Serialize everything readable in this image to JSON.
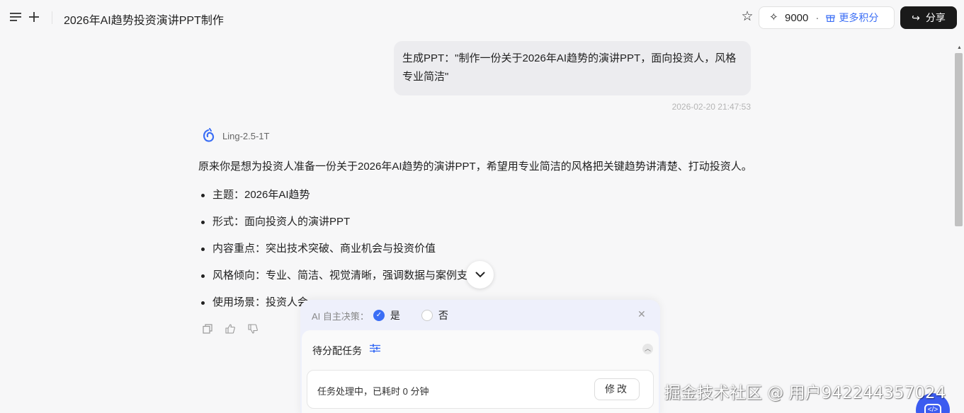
{
  "header": {
    "title": "2026年AI趋势投资演讲PPT制作",
    "points_value": "9000",
    "points_separator": "·",
    "more_points_label": "更多积分",
    "share_label": "分享"
  },
  "conversation": {
    "user_message": "生成PPT：\"制作一份关于2026年AI趋势的演讲PPT，面向投资人，风格专业简洁\"",
    "timestamp": "2026-02-20 21:47:53",
    "model_name": "Ling-2.5-1T",
    "answer_intro": "原来你是想为投资人准备一份关于2026年AI趋势的演讲PPT，希望用专业简洁的风格把关键趋势讲清楚、打动投资人。",
    "bullets": [
      "主题：2026年AI趋势",
      "形式：面向投资人的演讲PPT",
      "内容重点：突出技术突破、商业机会与投资价值",
      "风格倾向：专业、简洁、视觉清晰，强调数据与案例支",
      "使用场景：投资人会"
    ]
  },
  "task_panel": {
    "ai_decision_label": "AI 自主决策：",
    "yes_label": "是",
    "no_label": "否",
    "yes_selected": true,
    "pending_title": "待分配任务",
    "status_text": "任务处理中，已耗时 0 分钟",
    "modify_label": "修改"
  },
  "watermark": "掘金技术社区 @ 用户942244357024",
  "colors": {
    "accent": "#3b6ef5",
    "share_bg": "#1a1a1a",
    "panel_bg": "#eef0fb"
  }
}
